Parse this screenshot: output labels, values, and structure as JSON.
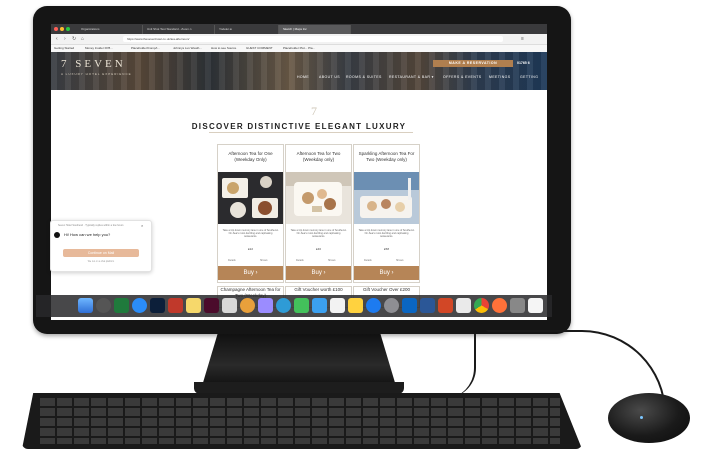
{
  "browser": {
    "tabs": [
      {
        "label": "Organizations"
      },
      {
        "label": "Unit Shot Test Standard - Zoom.n"
      },
      {
        "label": "Yodeler.io"
      },
      {
        "label": "Sketch | Maps Inc"
      }
    ],
    "url": "https://www.thesevenhotel.co.uk/tea-afternoon/",
    "bookmarks": [
      "Getting Started",
      "Money Insider FP8...",
      "Placeholder/Comp/t...",
      "Johnnys Lux Weath...",
      "How to see Source",
      "GUEST COMMENT",
      "Placeholder Plot... Pla..."
    ]
  },
  "site": {
    "brand": "7 SEVEN",
    "brand_sub": "A LUXURY HOTEL EXPERIENCE",
    "reserve_label": "MAKE A RESERVATION",
    "phone": "01765 6",
    "menu": [
      "HOME",
      "ABOUT US",
      "ROOMS & SUITES",
      "RESTAURANT & BAR ▾",
      "OFFERS & EVENTS",
      "MEETINGS",
      "GETTING"
    ],
    "section_title": "DISCOVER DISTINCTIVE ELEGANT LUXURY",
    "cards": [
      {
        "title": "Afternoon Tea for One (Weekday Only)",
        "desc": "Take a trip down memory lane in one of Southend-On-Sea's most dazzling and captivating restaurants.",
        "price": "£22",
        "details": "Details",
        "shows": "Shows",
        "buy": "Buy ›"
      },
      {
        "title": "Afternoon Tea for Two (Weekday only)",
        "desc": "Take a trip down memory lane in one of Southend-On-Sea's most dazzling and captivating restaurants.",
        "price": "£46",
        "details": "Details",
        "shows": "Shows",
        "buy": "Buy ›"
      },
      {
        "title": "Sparkling Afternoon Tea For Two (Weekday only)",
        "desc": "Take a trip down memory lane in one of Southend-On-Sea's most dazzling and captivating restaurants.",
        "price": "£58",
        "details": "Details",
        "shows": "Shows",
        "buy": "Buy ›"
      }
    ],
    "cards_row2": [
      "Champagne Afternoon Tea for Two (Weekday)",
      "Gift Voucher worth £100",
      "Gift Voucher Over £200"
    ]
  },
  "chat": {
    "header": "Seven Hotel Southend · Typically replies within a few hours",
    "message": "Hi! How can we help you?",
    "button": "Continue on Mail",
    "footer": "We run on a chat platform"
  },
  "colors": {
    "accent": "#b68557",
    "nav_bg": "#1f3a5a"
  }
}
